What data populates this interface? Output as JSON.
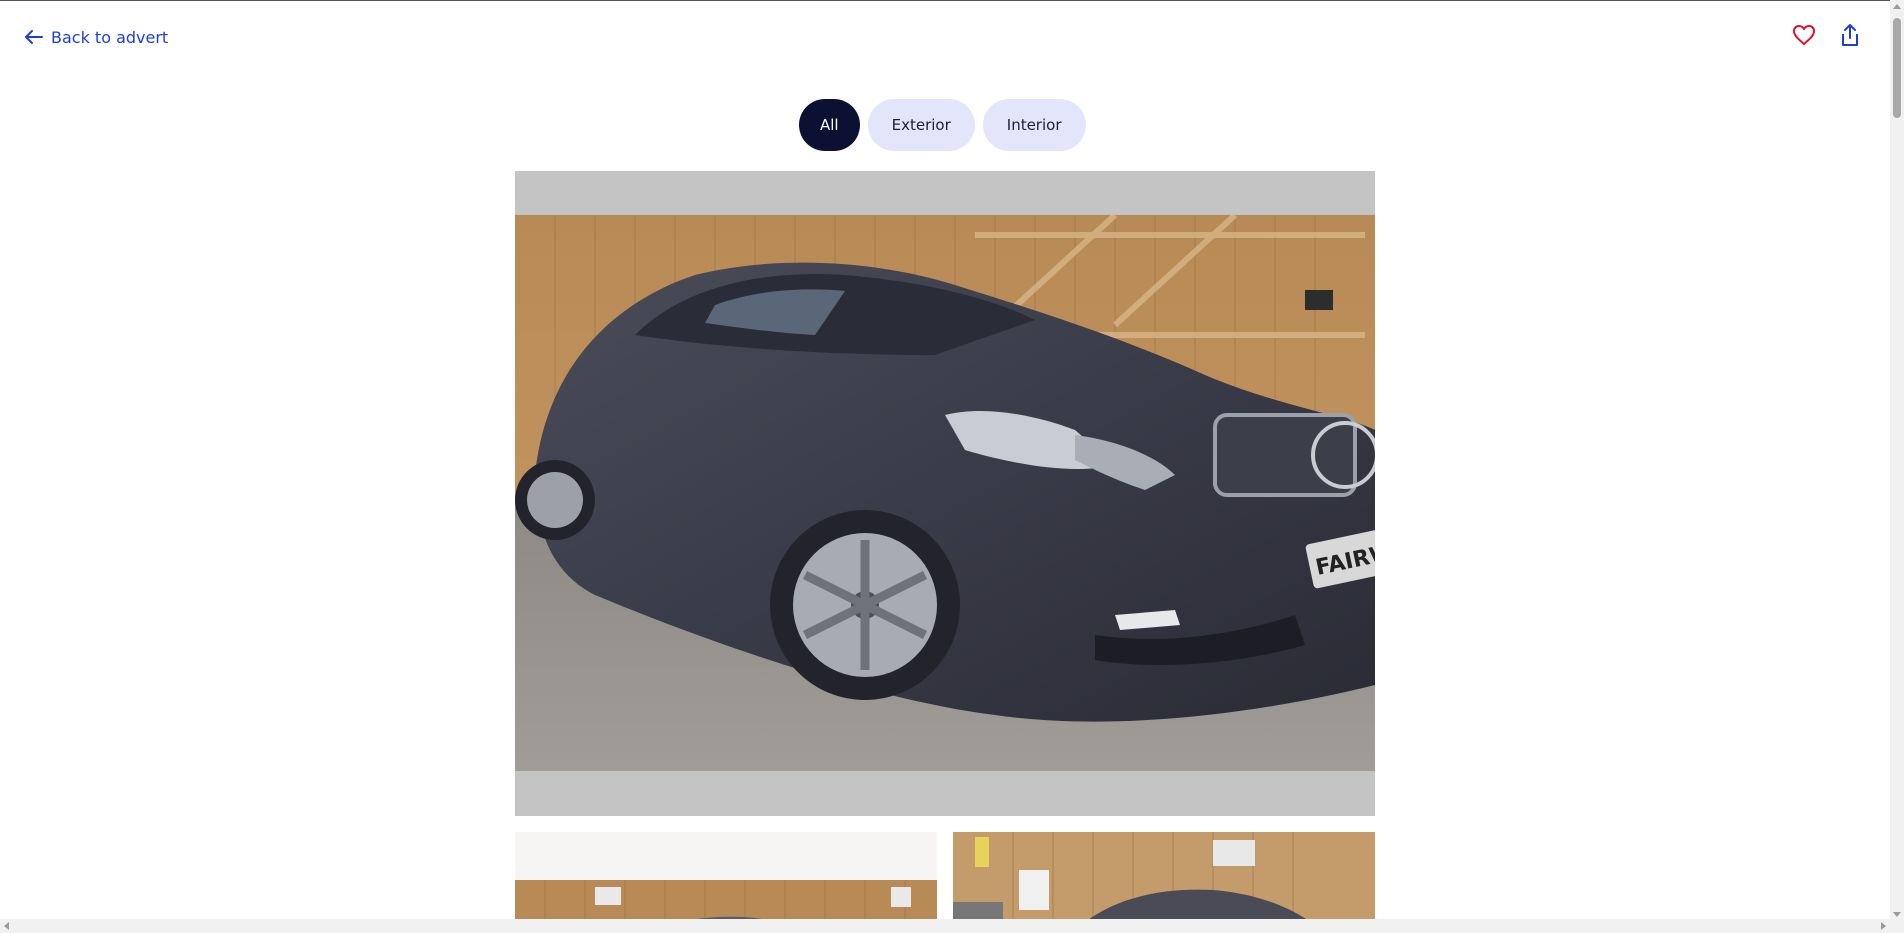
{
  "header": {
    "back_label": "Back to advert",
    "back_icon": "arrow-left-icon",
    "favourite_icon": "heart-icon",
    "share_icon": "share-icon"
  },
  "tabs": [
    {
      "label": "All",
      "active": true
    },
    {
      "label": "Exterior",
      "active": false
    },
    {
      "label": "Interior",
      "active": false
    }
  ],
  "gallery": {
    "main_photo": {
      "subject": "grey coupe car in wooden garage",
      "plate_text": "FAIRWAY"
    },
    "thumbnails": [
      {
        "subject": "car interior of wooden garage, partial view"
      },
      {
        "subject": "car in garage with signage, partial view"
      }
    ]
  },
  "colors": {
    "accent": "#1d3fd8",
    "favourite": "#e0102a",
    "active_tab": "#0c1134",
    "inactive_tab": "#e3e6fb"
  }
}
